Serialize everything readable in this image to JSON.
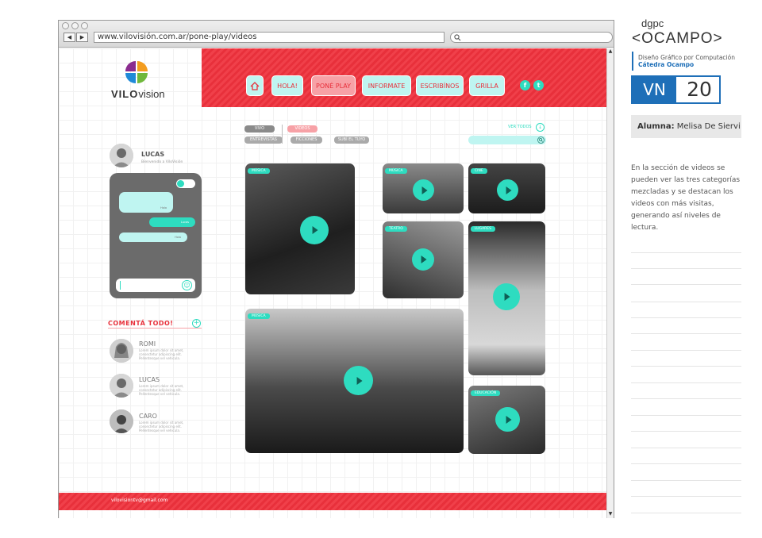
{
  "browser": {
    "url": "www.vilovisión.com.ar/pone-play/videos",
    "back_label": "◀",
    "forward_label": "▶"
  },
  "site": {
    "logo_bold": "VILO",
    "logo_rest": "vision",
    "menu": [
      "HOLA!",
      "PONÉ PLAY",
      "INFORMATE",
      "ESCRIBÍNOS",
      "GRILLA"
    ],
    "active_menu": "PONÉ PLAY",
    "social": [
      "f",
      "t"
    ]
  },
  "filters": {
    "row1": [
      "VIVO",
      "VIDEOS"
    ],
    "row2": [
      "ENTREVISTAS",
      "FICCIONES",
      "SUBÍ EL TUYO"
    ],
    "ver_todos": "VER TODOS"
  },
  "user": {
    "name": "LUCAS",
    "welcome": "Bienvenido a ViloVisión"
  },
  "chat": {
    "bubbles": [
      "Hola",
      "Lucas",
      "Hola"
    ]
  },
  "comments": {
    "title": "COMENTÁ TODO!",
    "items": [
      {
        "name": "ROMI",
        "text": "Lorem ipsum dolor sit amet, consectetur adipiscing elit. Pellentesque vel vehicula."
      },
      {
        "name": "LUCAS",
        "text": "Lorem ipsum dolor sit amet, consectetur adipiscing elit. Pellentesque vel vehicula."
      },
      {
        "name": "CARO",
        "text": "Lorem ipsum dolor sit amet, consectetur adipiscing elit. Pellentesque vel vehicula."
      }
    ]
  },
  "videos": [
    {
      "tag": "MÚSICA"
    },
    {
      "tag": "MÚSICA"
    },
    {
      "tag": "CINE"
    },
    {
      "tag": "TEATRO"
    },
    {
      "tag": "LUGARES"
    },
    {
      "tag": "MÚSICA"
    },
    {
      "tag": "EDUCACIÓN"
    }
  ],
  "footer": {
    "email": "vilovisiontv@gmail.com"
  },
  "panel": {
    "dgpc": "dgpc",
    "ocampo": "<OCAMPO>",
    "sub1": "Diseño Gráfico por Computación",
    "sub2": "Cátedra Ocampo",
    "vn": "VN",
    "number": "20",
    "alumna_label": "Alumna:",
    "alumna_name": "Melisa De Siervi",
    "description": "En la sección de videos se pueden ver las tres categorías mezcladas y se destacan los videos con más visitas, generando así niveles de lectura."
  },
  "colors": {
    "accent_red": "#e8303b",
    "accent_teal": "#2edcc0",
    "panel_blue": "#1e6fb8"
  }
}
